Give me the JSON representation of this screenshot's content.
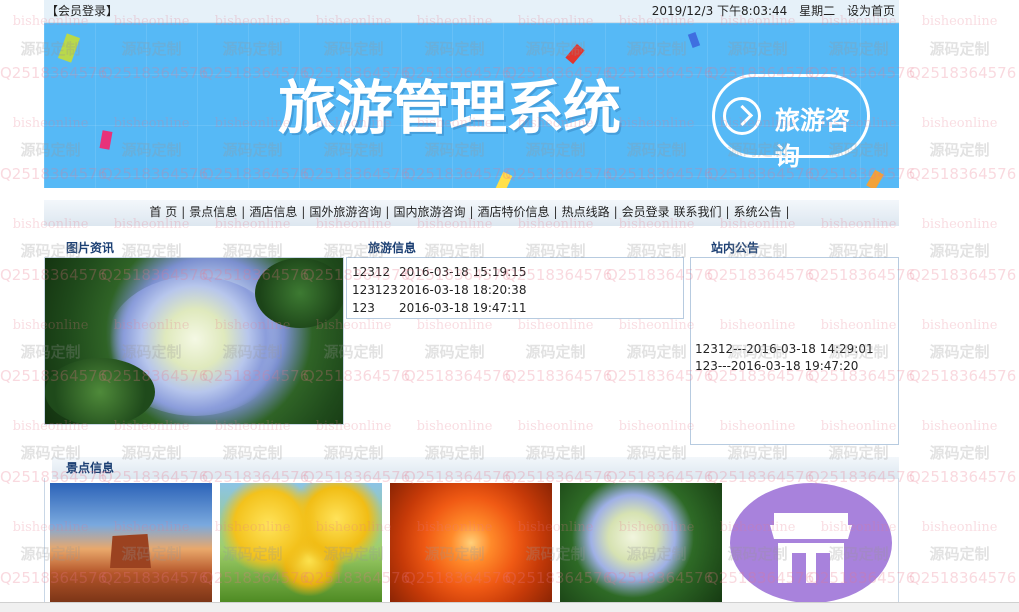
{
  "topbar": {
    "login": "【会员登录】",
    "datetime": "2019/12/3 下午8:03:44",
    "weekday": "星期二",
    "set_home": "设为首页"
  },
  "banner": {
    "title": "旅游管理系统",
    "consult": "旅游咨询",
    "bg_color": "#56b9f6"
  },
  "nav": {
    "items": [
      "首 页",
      "景点信息",
      "酒店信息",
      "国外旅游咨询",
      "国内旅游咨询",
      "酒店特价信息",
      "热点线路",
      "会员登录 联系我们",
      "系统公告"
    ]
  },
  "sections": {
    "pictures": "图片资讯",
    "travel_info": "旅游信息",
    "notice": "站内公告",
    "scenic": "景点信息"
  },
  "travel_info": [
    {
      "title": "12312",
      "date": "2016-03-18 15:19:15"
    },
    {
      "title": "123123",
      "date": "2016-03-18 18:20:38"
    },
    {
      "title": "123",
      "date": "2016-03-18 19:47:11"
    }
  ],
  "notices": [
    "12312---2016-03-18 14:29:01",
    "123---2016-03-18 19:47:20"
  ],
  "scenic_thumbs": [
    "desert-mesa-photo",
    "yellow-tulips-photo",
    "orange-chrysanthemum-photo",
    "hydrangea-photo",
    "store-icon"
  ],
  "watermark": {
    "text1": "bisheonline",
    "text2": "源码定制",
    "text3": "Q2518364576"
  }
}
